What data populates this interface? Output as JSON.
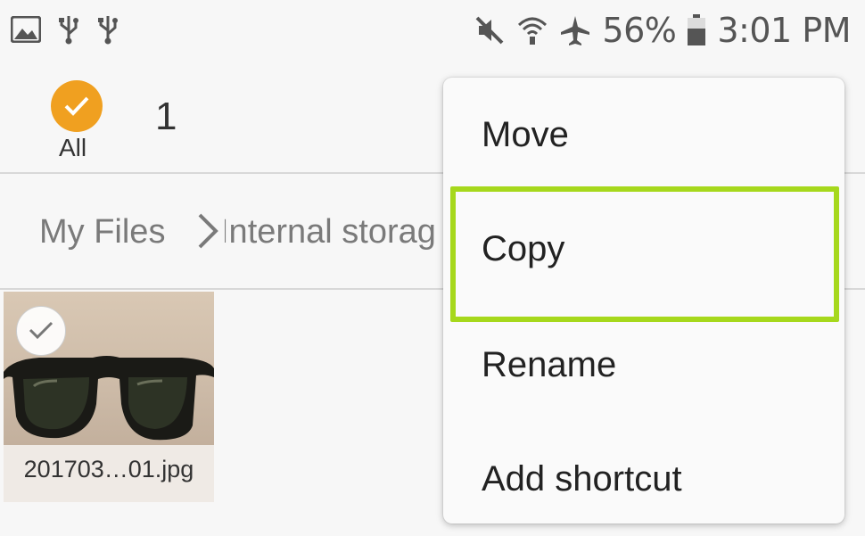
{
  "status_bar": {
    "left_icons": [
      "gallery-icon",
      "usb-icon",
      "usb-icon"
    ],
    "right_icons": [
      "mute-icon",
      "wifi-icon",
      "airplane-icon",
      "battery-icon"
    ],
    "battery": "56%",
    "time": "3:01 PM"
  },
  "selection": {
    "all_label": "All",
    "count": "1"
  },
  "breadcrumb": {
    "root": "My Files",
    "current": "Internal storag"
  },
  "files": [
    {
      "name": "201703…01.jpg",
      "selected": true
    }
  ],
  "menu": {
    "items": [
      {
        "label": "Move"
      },
      {
        "label": "Copy"
      },
      {
        "label": "Rename"
      },
      {
        "label": "Add shortcut"
      }
    ],
    "highlighted": "Copy",
    "highlight_color": "#a6d81c"
  },
  "colors": {
    "select_all_accent": "#f0a020"
  }
}
